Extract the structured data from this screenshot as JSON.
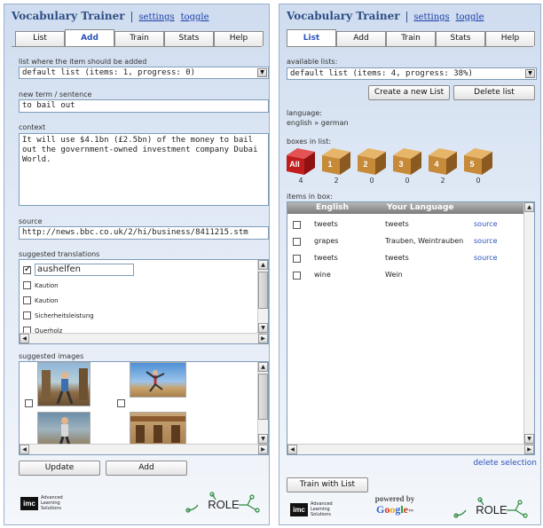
{
  "left": {
    "title": "Vocabulary Trainer",
    "title_sep": "|",
    "settings_link": "settings",
    "toggle_link": "toggle",
    "tabs": [
      {
        "label": "List",
        "active": false
      },
      {
        "label": "Add",
        "active": true
      },
      {
        "label": "Train",
        "active": false
      },
      {
        "label": "Stats",
        "active": false
      },
      {
        "label": "Help",
        "active": false
      }
    ],
    "list_label": "list where the item should be added",
    "list_value": "default list (items: 1, progress: 0)",
    "term_label": "new term / sentence",
    "term_value": "to bail out",
    "context_label": "context",
    "context_value": "It will use $4.1bn (£2.5bn) of the money to bail out the government-owned investment company Dubai World.",
    "source_label": "source",
    "source_value": "http://news.bbc.co.uk/2/hi/business/8411215.stm",
    "suggested_translations_label": "suggested translations",
    "translations": [
      {
        "text": "aushelfen",
        "checked": true
      },
      {
        "text": "Kaution",
        "checked": false
      },
      {
        "text": "Kaution",
        "checked": false
      },
      {
        "text": "Sicherheitsleistung",
        "checked": false
      },
      {
        "text": "Querholz",
        "checked": false
      }
    ],
    "suggested_images_label": "suggested images",
    "update_button": "Update",
    "add_button": "Add",
    "imc_logo": "imc",
    "imc_text": [
      "Advanced",
      "Learning",
      "Solutions"
    ],
    "role_logo": "ROLE"
  },
  "right": {
    "title": "Vocabulary Trainer",
    "title_sep": "|",
    "settings_link": "settings",
    "toggle_link": "toggle",
    "tabs": [
      {
        "label": "List",
        "active": true
      },
      {
        "label": "Add",
        "active": false
      },
      {
        "label": "Train",
        "active": false
      },
      {
        "label": "Stats",
        "active": false
      },
      {
        "label": "Help",
        "active": false
      }
    ],
    "available_lists_label": "available lists:",
    "available_lists_value": "default list (items: 4, progress: 38%)",
    "create_button": "Create a new List",
    "delete_button": "Delete list",
    "language_label": "language:",
    "language_value": "english » german",
    "boxes_label": "boxes in list:",
    "boxes": [
      {
        "label": "All",
        "count": "4"
      },
      {
        "label": "1",
        "count": "2"
      },
      {
        "label": "2",
        "count": "0"
      },
      {
        "label": "3",
        "count": "0"
      },
      {
        "label": "4",
        "count": "2"
      },
      {
        "label": "5",
        "count": "0"
      }
    ],
    "items_label": "items in box:",
    "col_english": "English",
    "col_your_language": "Your Language",
    "items": [
      {
        "english": "tweets",
        "translation": "tweets",
        "source": "source"
      },
      {
        "english": "grapes",
        "translation": "Trauben, Weintrauben",
        "source": "source"
      },
      {
        "english": "tweets",
        "translation": "tweets",
        "source": "source"
      },
      {
        "english": "wine",
        "translation": "Wein",
        "source": ""
      }
    ],
    "delete_selection": "delete selection",
    "train_button": "Train with List",
    "powered_by": "powered by",
    "google_letters": [
      "G",
      "o",
      "o",
      "g",
      "l",
      "e"
    ],
    "google_tm": "™",
    "imc_logo": "imc",
    "imc_text": [
      "Advanced",
      "Learning",
      "Solutions"
    ],
    "role_logo": "ROLE"
  }
}
